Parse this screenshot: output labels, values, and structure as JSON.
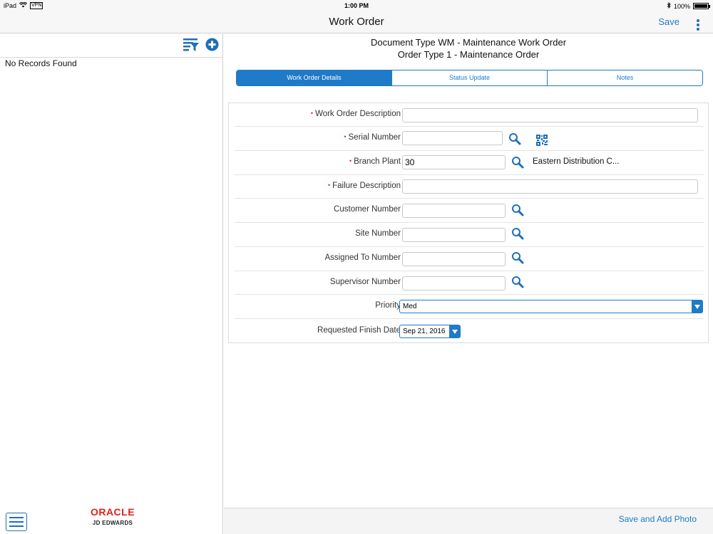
{
  "status_bar": {
    "device": "iPad",
    "vpn": "VPN",
    "time": "1:00 PM",
    "battery": "100%",
    "battery_level": 1.0
  },
  "nav": {
    "title": "Work Order",
    "save_label": "Save"
  },
  "left_pane": {
    "empty_message": "No Records Found",
    "logo_line1": "ORACLE",
    "logo_line2": "JD EDWARDS"
  },
  "header": {
    "line1": "Document Type WM - Maintenance Work Order",
    "line2": "Order Type 1 - Maintenance Order"
  },
  "tabs": [
    {
      "label": "Work Order Details",
      "active": true
    },
    {
      "label": "Status Update",
      "active": false
    },
    {
      "label": "Notes",
      "active": false
    }
  ],
  "form": {
    "work_order_description": {
      "label": "Work Order Description",
      "required": true,
      "value": ""
    },
    "serial_number": {
      "label": "Serial Number",
      "required": true,
      "value": ""
    },
    "branch_plant": {
      "label": "Branch Plant",
      "required": true,
      "value": "30",
      "description": "Eastern Distribution C..."
    },
    "failure_description": {
      "label": "Failure Description",
      "required": true,
      "value": ""
    },
    "customer_number": {
      "label": "Customer Number",
      "value": ""
    },
    "site_number": {
      "label": "Site Number",
      "value": ""
    },
    "assigned_to_number": {
      "label": "Assigned To Number",
      "value": ""
    },
    "supervisor_number": {
      "label": "Supervisor Number",
      "value": ""
    },
    "priority": {
      "label": "Priority",
      "value": "Med"
    },
    "requested_finish_date": {
      "label": "Requested Finish Date",
      "value": "Sep 21, 2016"
    }
  },
  "bottom": {
    "save_add_photo_label": "Save and Add Photo"
  },
  "colors": {
    "accent": "#1f7ac8",
    "required": "#d0302a",
    "oracle_red": "#e0201b"
  }
}
